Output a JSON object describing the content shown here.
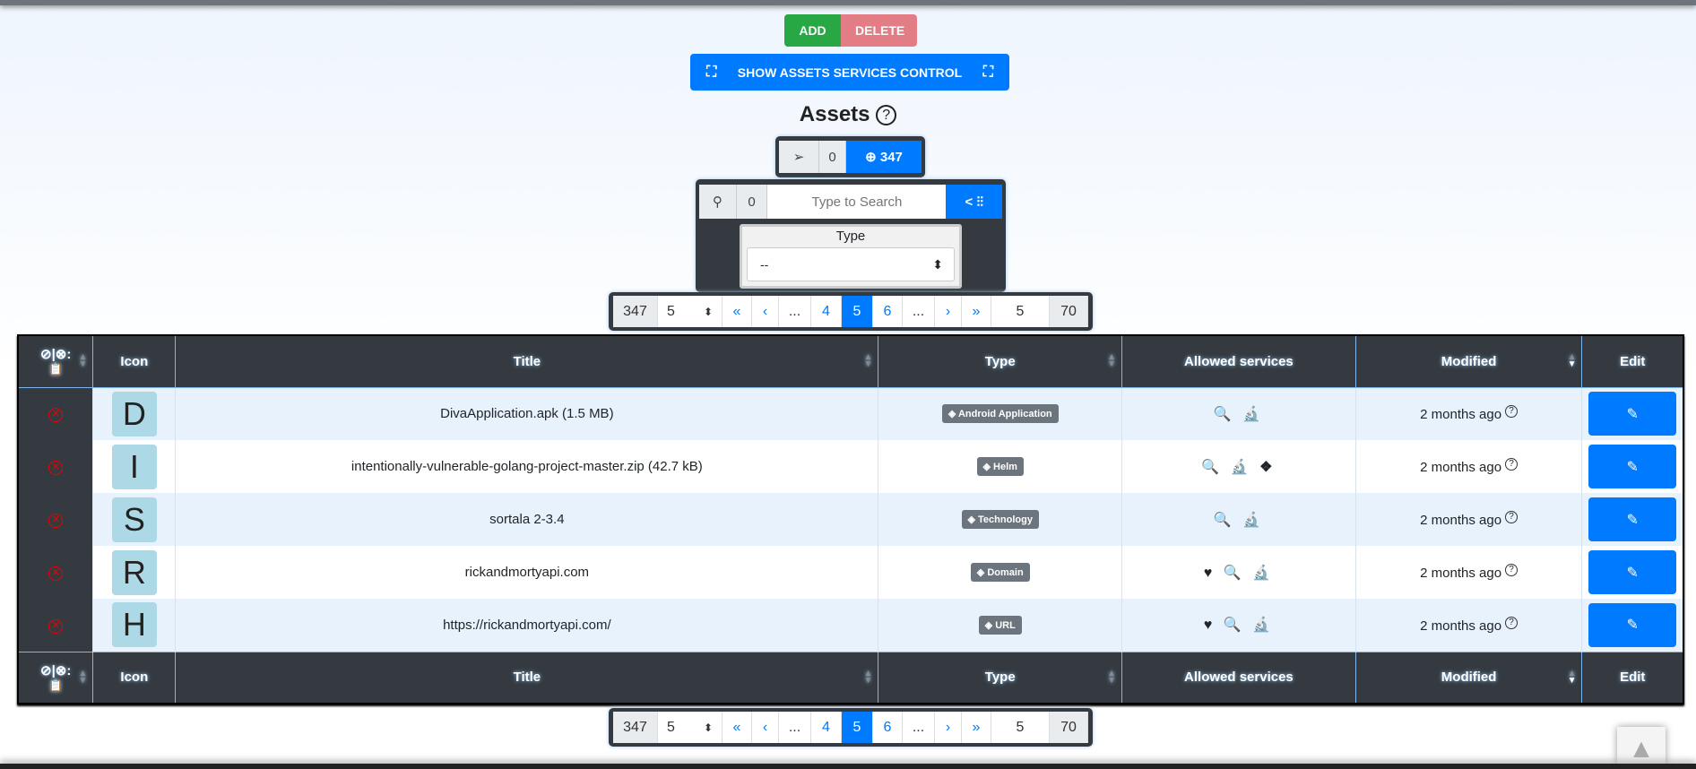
{
  "toolbar": {
    "add": "ADD",
    "delete": "DELETE",
    "show_control": "SHOW ASSETS SERVICES CONTROL"
  },
  "title": "Assets",
  "counter": {
    "selected": "0",
    "total": "347"
  },
  "search": {
    "count": "0",
    "placeholder": "Type to Search",
    "filter_toggle": "<",
    "type_label": "Type",
    "type_value": "--"
  },
  "pagination": {
    "total": "347",
    "per_page": "5",
    "first": "«",
    "prev": "‹",
    "ellipsis": "...",
    "pages": [
      "4",
      "5",
      "6"
    ],
    "current": "5",
    "next": "›",
    "last": "»",
    "goto": "5",
    "page_count": "70"
  },
  "table": {
    "headers": {
      "select": "⊘|⊗:",
      "icon": "Icon",
      "title": "Title",
      "type": "Type",
      "services": "Allowed services",
      "modified": "Modified",
      "edit": "Edit"
    },
    "rows": [
      {
        "letter": "D",
        "title": "DivaApplication.apk (1.5 MB)",
        "type": "Android Application",
        "type_icon": "android-icon",
        "services": "🔍 🔬",
        "modified": "2 months ago"
      },
      {
        "letter": "I",
        "title": "intentionally-vulnerable-golang-project-master.zip (42.7 kB)",
        "type": "Helm",
        "type_icon": "helm-icon",
        "services": "🔍 🔬 ❖",
        "modified": "2 months ago"
      },
      {
        "letter": "S",
        "title": "sortala 2-3.4",
        "type": "Technology",
        "type_icon": "technology-icon",
        "services": "🔍 🔬",
        "modified": "2 months ago"
      },
      {
        "letter": "R",
        "title": "rickandmortyapi.com",
        "type": "Domain",
        "type_icon": "link-icon",
        "services": "♥ 🔍 🔬",
        "modified": "2 months ago"
      },
      {
        "letter": "H",
        "title": "https://rickandmortyapi.com/",
        "type": "URL",
        "type_icon": "link-icon",
        "services": "♥ 🔍 🔬",
        "modified": "2 months ago"
      }
    ]
  },
  "colors": {
    "primary": "#007bff",
    "success": "#28a745",
    "danger": "#e27c85",
    "dark": "#343a40"
  }
}
